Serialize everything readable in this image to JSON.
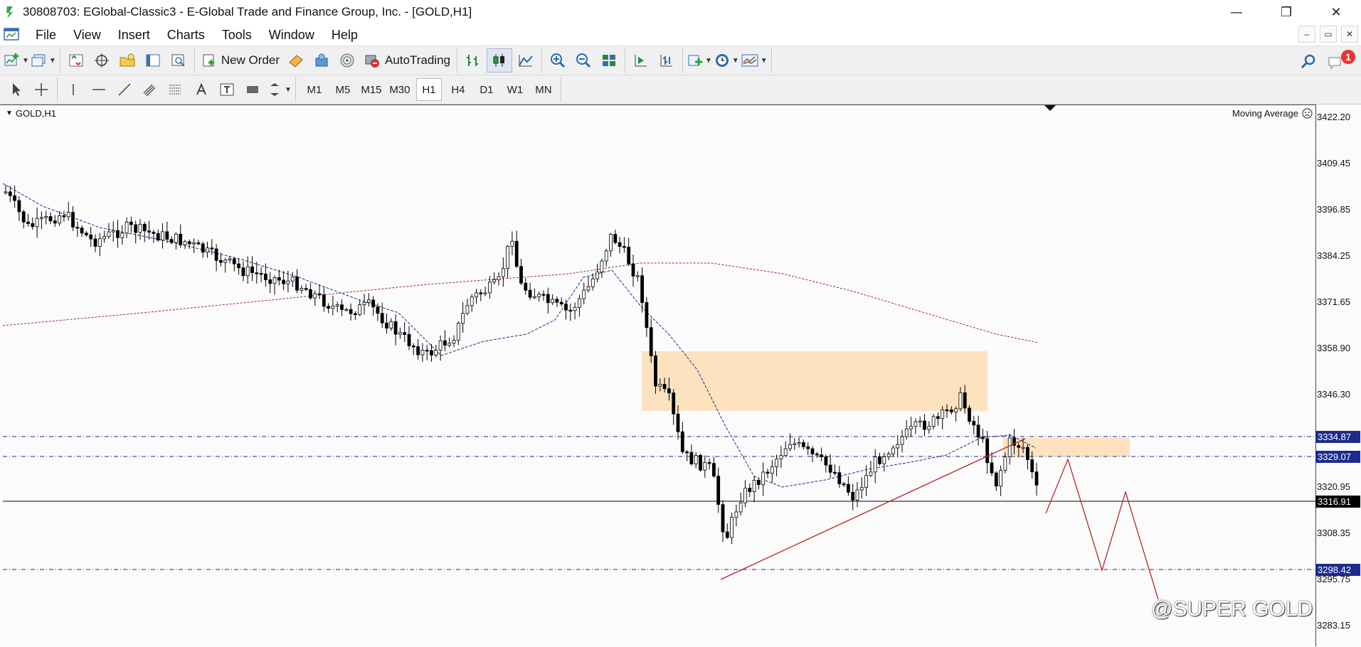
{
  "window": {
    "title": "30808703: EGlobal-Classic3 - E-Global Trade and Finance Group, Inc. - [GOLD,H1]",
    "minimize": "—",
    "maximize": "❐",
    "close": "✕"
  },
  "menu": {
    "items": [
      "File",
      "View",
      "Insert",
      "Charts",
      "Tools",
      "Window",
      "Help"
    ],
    "mdi_controls": [
      "–",
      "▭",
      "✕"
    ]
  },
  "toolbar": {
    "new_order_label": "New Order",
    "autotrading_label": "AutoTrading",
    "notification_count": "1"
  },
  "timeframes": {
    "items": [
      "M1",
      "M5",
      "M15",
      "M30",
      "H1",
      "H4",
      "D1",
      "W1",
      "MN"
    ],
    "active": "H1"
  },
  "chart": {
    "symbol_label": "GOLD,H1",
    "indicator_label": "Moving Average",
    "price_ticks": [
      "3422.20",
      "3409.45",
      "3396.85",
      "3384.25",
      "3371.65",
      "3358.90",
      "3346.30",
      "3320.95",
      "3308.35",
      "3295.75",
      "3283.15"
    ],
    "price_tags": [
      {
        "value": "3334.87",
        "color": "#1e2a8c"
      },
      {
        "value": "3329.07",
        "color": "#1e2a8c"
      },
      {
        "value": "3316.91",
        "color": "#000000"
      },
      {
        "value": "3298.42",
        "color": "#1e2a8c"
      }
    ],
    "watermark": "@SUPER GOLD",
    "colors": {
      "zone": "#fde2c0",
      "hline": "#1e2a8c",
      "ma_slow": "#a0283a",
      "ma_fast": "#1e2a8c",
      "drawing": "#b22a2a",
      "candle": "#000000"
    }
  }
}
